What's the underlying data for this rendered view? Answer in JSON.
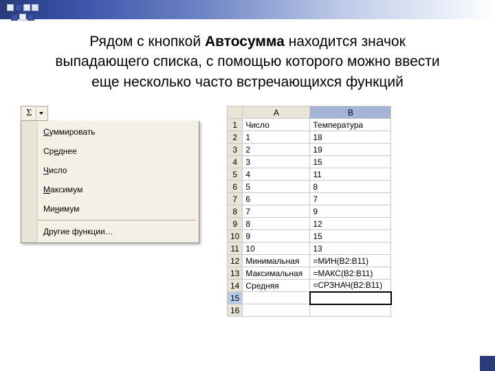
{
  "heading": {
    "pre": "Рядом с кнопкой ",
    "bold": "Автосумма",
    "post": " находится значок выпадающего списка, с помощью которого можно ввести еще несколько часто встречающихся функций"
  },
  "autosum": {
    "sigma": "Σ"
  },
  "menu": {
    "items": [
      {
        "pre": "",
        "u": "С",
        "post": "уммировать"
      },
      {
        "pre": "Ср",
        "u": "е",
        "post": "днее"
      },
      {
        "pre": "",
        "u": "Ч",
        "post": "исло"
      },
      {
        "pre": "",
        "u": "М",
        "post": "аксимум"
      },
      {
        "pre": "Ми",
        "u": "н",
        "post": "имум"
      },
      {
        "pre": "",
        "u": "Д",
        "post": "ругие функции…"
      }
    ]
  },
  "sheet": {
    "col_a": "A",
    "col_b": "B",
    "rows": [
      {
        "n": "1",
        "a": "Число",
        "b": "Температура"
      },
      {
        "n": "2",
        "a": "1",
        "b": "18"
      },
      {
        "n": "3",
        "a": "2",
        "b": "19"
      },
      {
        "n": "4",
        "a": "3",
        "b": "15"
      },
      {
        "n": "5",
        "a": "4",
        "b": "11"
      },
      {
        "n": "6",
        "a": "5",
        "b": "8"
      },
      {
        "n": "7",
        "a": "6",
        "b": "7"
      },
      {
        "n": "8",
        "a": "7",
        "b": "9"
      },
      {
        "n": "9",
        "a": "8",
        "b": "12"
      },
      {
        "n": "10",
        "a": "9",
        "b": "15"
      },
      {
        "n": "11",
        "a": "10",
        "b": "13"
      },
      {
        "n": "12",
        "a": "Минимальная",
        "b": "=МИН(B2:B11)"
      },
      {
        "n": "13",
        "a": "Максимальная",
        "b": "=МАКС(B2:B11)"
      },
      {
        "n": "14",
        "a": "Средняя",
        "b": "=СРЗНАЧ(B2:B11)"
      },
      {
        "n": "15",
        "a": "",
        "b": ""
      },
      {
        "n": "16",
        "a": "",
        "b": ""
      }
    ]
  }
}
